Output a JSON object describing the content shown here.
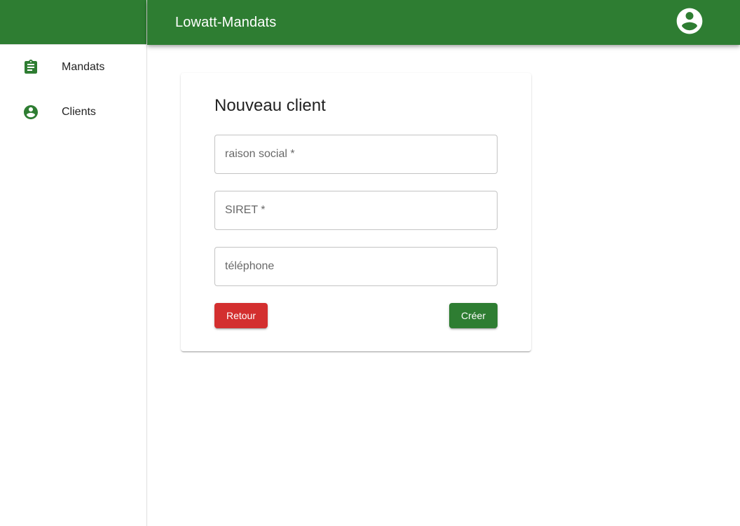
{
  "app": {
    "title": "Lowatt-Mandats"
  },
  "colors": {
    "primary": "#2e7d32",
    "danger": "#d32f2f"
  },
  "sidebar": {
    "items": [
      {
        "label": "Mandats",
        "icon": "assignment-icon"
      },
      {
        "label": "Clients",
        "icon": "account-circle-icon"
      }
    ]
  },
  "header": {
    "account_icon": "account-circle-icon"
  },
  "form": {
    "title": "Nouveau client",
    "fields": [
      {
        "placeholder": "raison social *",
        "value": ""
      },
      {
        "placeholder": "SIRET *",
        "value": ""
      },
      {
        "placeholder": "téléphone",
        "value": ""
      }
    ],
    "back_label": "Retour",
    "create_label": "Créer"
  }
}
